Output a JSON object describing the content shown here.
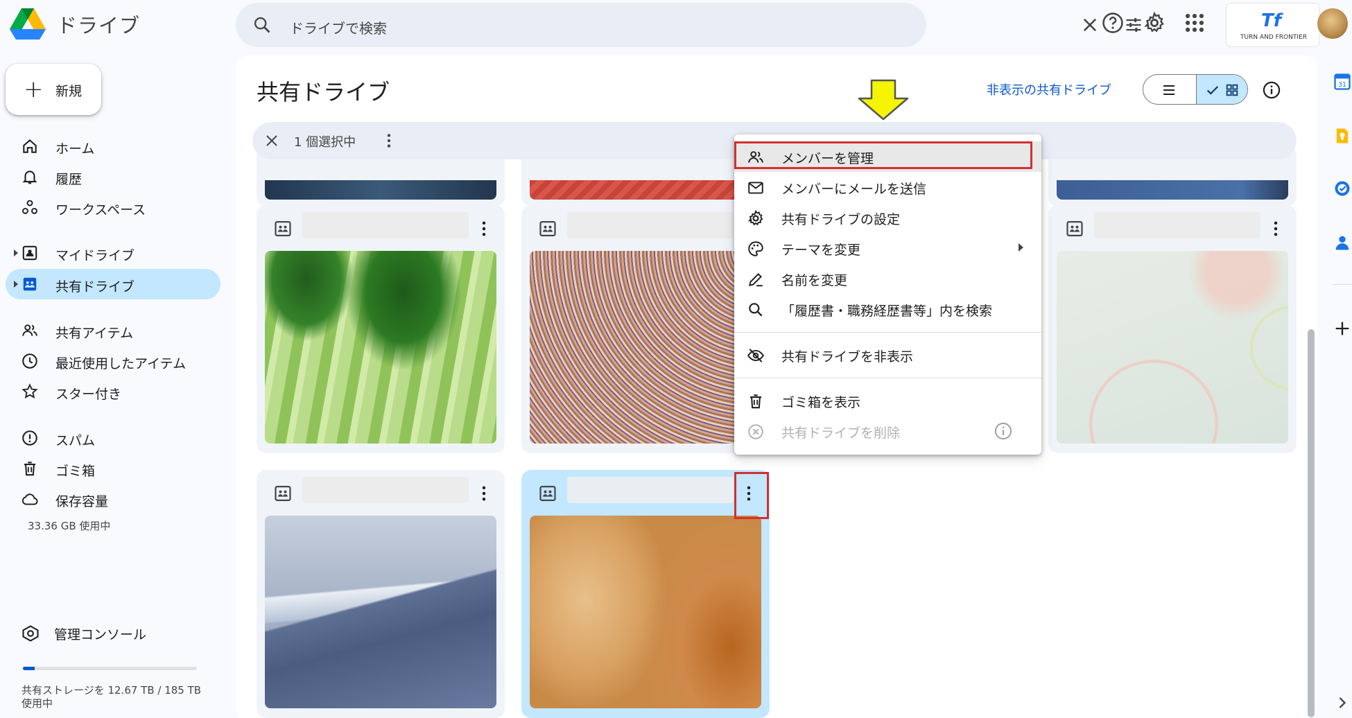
{
  "app": {
    "title": "ドライブ"
  },
  "search": {
    "placeholder": "ドライブで検索"
  },
  "org_logo": {
    "mark": "Tf",
    "name": "TURN AND FRONTIER"
  },
  "sidebar": {
    "new_label": "新規",
    "items": [
      {
        "label": "ホーム",
        "icon": "home-icon"
      },
      {
        "label": "履歴",
        "icon": "bell-icon"
      },
      {
        "label": "ワークスペース",
        "icon": "workspaces-icon"
      },
      {
        "label": "マイドライブ",
        "icon": "my-drive-icon"
      },
      {
        "label": "共有ドライブ",
        "icon": "shared-drive-icon",
        "active": true
      },
      {
        "label": "共有アイテム",
        "icon": "people-icon"
      },
      {
        "label": "最近使用したアイテム",
        "icon": "clock-icon"
      },
      {
        "label": "スター付き",
        "icon": "star-icon"
      },
      {
        "label": "スパム",
        "icon": "spam-icon"
      },
      {
        "label": "ゴミ箱",
        "icon": "trash-icon"
      },
      {
        "label": "保存容量",
        "icon": "cloud-icon"
      }
    ],
    "storage_used": "33.36 GB 使用中",
    "admin_console": "管理コンソール",
    "quota_text": "共有ストレージを 12.67 TB / 185 TB 使用中",
    "quota_fraction": 0.068
  },
  "main": {
    "title": "共有ドライブ",
    "hidden_drives_link": "非表示の共有ドライブ",
    "selection_count": "1 個選択中"
  },
  "context_menu": {
    "items": [
      {
        "label": "メンバーを管理",
        "icon": "manage-members-icon"
      },
      {
        "label": "メンバーにメールを送信",
        "icon": "mail-icon"
      },
      {
        "label": "共有ドライブの設定",
        "icon": "gear-icon"
      },
      {
        "label": "テーマを変更",
        "icon": "palette-icon"
      },
      {
        "label": "名前を変更",
        "icon": "rename-icon"
      },
      {
        "label": "「履歴書・職務経歴書等」内を検索",
        "icon": "search-icon"
      },
      {
        "label": "共有ドライブを非表示",
        "icon": "hide-icon"
      },
      {
        "label": "ゴミ箱を表示",
        "icon": "trash-icon"
      },
      {
        "label": "共有ドライブを削除",
        "icon": "delete-circle-icon",
        "disabled": true
      }
    ]
  },
  "colors": {
    "accent": "#0b57d0",
    "active_nav": "#c2e7ff",
    "highlight_box": "#d32f2f",
    "arrow": "#f5f500"
  }
}
